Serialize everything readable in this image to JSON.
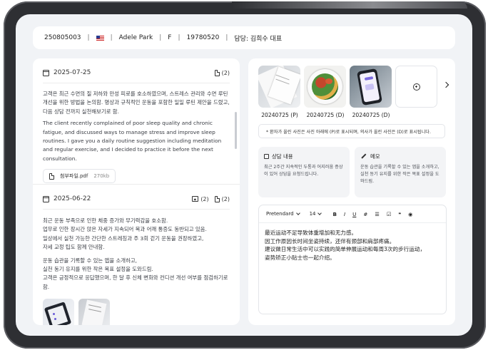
{
  "header": {
    "patient_id": "250805003",
    "flag": "us-flag-icon",
    "name": "Adele Park",
    "sex": "F",
    "birth": "19780520",
    "manager": "담당: 김희수 대표"
  },
  "consultations": [
    {
      "date": "2025-07-25",
      "doc_count": "(2)",
      "text_ko": "고객은 최근 수면의 질 저하와 만성 피로를 호소하였으며, 스트레스 관리와 수면 루틴 개선을 위한 방법을 논의함. 명상과 규칙적인 운동을 포함한 일일 루틴 제안을 드렸고, 다음 상담 전까지 실천해보기로 함.",
      "text_en": "The client recently complained of poor sleep quality and chronic fatigue, and discussed ways to manage stress and improve sleep routines. I gave you a daily routine suggestion including meditation and regular exercise, and I decided to practice it before the next consultation.",
      "file": {
        "name": "첨부파일.pdf",
        "size": "270kb"
      }
    },
    {
      "date": "2025-06-22",
      "image_count": "(2)",
      "doc_count": "(2)",
      "para1": [
        "최근 운동 부족으로 인한 체중 증가와 무기력감을 호소함.",
        "업무로 인한 장시간 앉은 자세가 지속되어 목과 어깨 통증도 동반되고 있음.",
        "일상에서 실천 가능한 간단한 스트레칭과 주 3회 걷기 운동을 권장하였고,",
        "자세 교정 팁도 함께 안내함."
      ],
      "para2": [
        "운동 습관을 기록할 수 있는 앱을 소개하고,",
        "실천 동기 유지를 위한 작은 목표 설정을 도와드림.",
        "고객은 긍정적으로 응답했으며, 한 달 후 신체 변화와 컨디션 개선 여부를 점검하기로 함."
      ]
    }
  ],
  "gallery": {
    "photos": [
      {
        "caption": "20240725 (P)",
        "kind": "papers"
      },
      {
        "caption": "20240725 (D)",
        "kind": "salad"
      },
      {
        "caption": "20240725 (D)",
        "kind": "phone"
      }
    ],
    "notice": "* 환자가 올린 사진은 사진 아래에 (P)로 표시되며, 의사가 올린 사진은 (D)로 표시됩니다."
  },
  "consult_card": {
    "title": "상담 내용",
    "body": "최근 2주간 지속적인 두통과 어지러움 증상이 있어 상담을 요청드립니다."
  },
  "memo_card": {
    "title": "메모",
    "body": "운동 습관을 기록할 수 있는 앱을 소개하고, 실천 동기 유지를 위한 작은 목표 설정을 도와드림."
  },
  "editor": {
    "font": "Pretendard",
    "size": "14",
    "tools": [
      "B",
      "I",
      "U",
      "#",
      "list-icon",
      "checkbox-icon",
      "quote-icon",
      "palette-icon"
    ],
    "lines": [
      "最近运动不足导致体重增加和无力感。",
      "因工作原因长时间坐姿持续，还伴有颈部和肩部疼痛。",
      "建议做日常生活中可以实践的简单伸展运动和每周3次的步行运动，",
      "姿势矫正小贴士也一起介绍。"
    ]
  }
}
